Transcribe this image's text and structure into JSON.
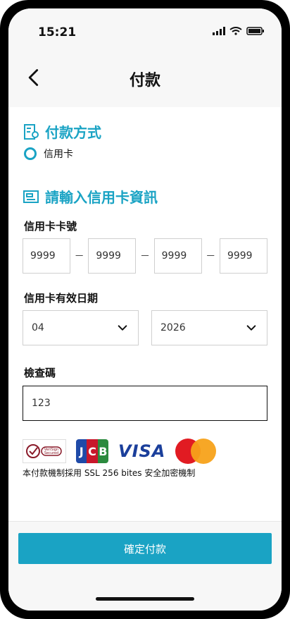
{
  "status": {
    "time": "15:21"
  },
  "header": {
    "title": "付款"
  },
  "section1": {
    "title": "付款方式",
    "option_label": "信用卡"
  },
  "section2": {
    "title": "請輸入信用卡資訊"
  },
  "card_number": {
    "label": "信用卡卡號",
    "parts": [
      "9999",
      "9999",
      "9999",
      "9999"
    ],
    "separator": "－"
  },
  "expiry": {
    "label": "信用卡有效日期",
    "month": "04",
    "year": "2026"
  },
  "cvv": {
    "label": "檢查碼",
    "value": "123"
  },
  "logos": {
    "visa": "VISA",
    "jcb": [
      "J",
      "C",
      "B"
    ],
    "verisign": [
      "VeriSign",
      "Secured"
    ]
  },
  "ssl_text": "本付款機制採用 SSL 256 bites 安全加密機制",
  "submit": {
    "label": "確定付款"
  },
  "colors": {
    "accent": "#1aa3c4",
    "border": "#cfcfcf"
  }
}
